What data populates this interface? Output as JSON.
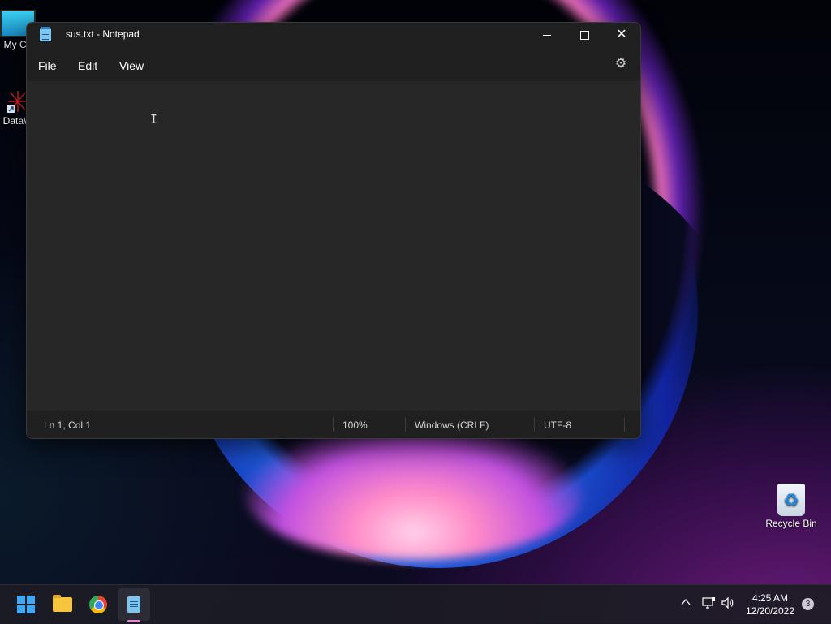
{
  "desktop": {
    "icons": [
      {
        "label": "My Co",
        "icon": "computer-icon"
      },
      {
        "label": "DataW",
        "icon": "datawarrior-icon"
      },
      {
        "label": "Recycle Bin",
        "icon": "recycle-bin-icon"
      }
    ]
  },
  "notepad": {
    "title": "sus.txt - Notepad",
    "menu": {
      "file": "File",
      "edit": "Edit",
      "view": "View"
    },
    "settings_icon": "gear-icon",
    "content": "",
    "status": {
      "position": "Ln 1, Col 1",
      "zoom": "100%",
      "line_endings": "Windows (CRLF)",
      "encoding": "UTF-8"
    }
  },
  "taskbar": {
    "apps": [
      "start-icon",
      "file-explorer-icon",
      "chrome-icon",
      "notepad-icon"
    ],
    "active_app": "notepad-icon",
    "clock": {
      "time": "4:25 AM",
      "date": "12/20/2022"
    },
    "notifications": "3"
  },
  "colors": {
    "window_bg": "#202020",
    "editor_bg": "#272727",
    "accent": "#3fa9f5"
  }
}
